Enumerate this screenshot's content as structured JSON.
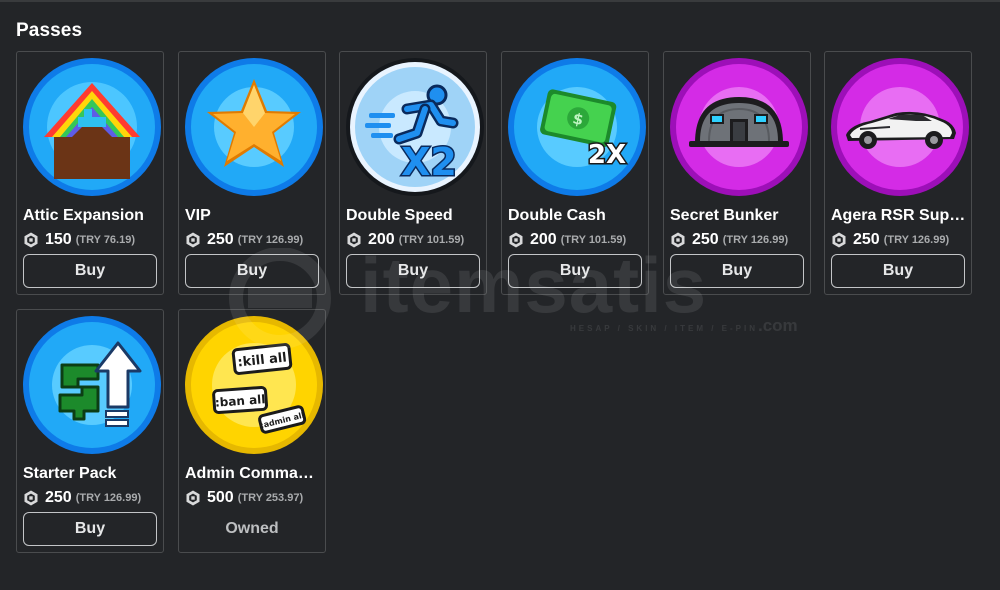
{
  "section": {
    "title": "Passes"
  },
  "passes": [
    {
      "name": "Attic Expansion",
      "price": "150",
      "local_price": "(TRY 76.19)",
      "action": "Buy",
      "icon": "attic-house-icon"
    },
    {
      "name": "VIP",
      "price": "250",
      "local_price": "(TRY 126.99)",
      "action": "Buy",
      "icon": "star-icon"
    },
    {
      "name": "Double Speed",
      "price": "200",
      "local_price": "(TRY 101.59)",
      "action": "Buy",
      "icon": "running-person-icon",
      "badge": "X2"
    },
    {
      "name": "Double Cash",
      "price": "200",
      "local_price": "(TRY 101.59)",
      "action": "Buy",
      "icon": "cash-icon",
      "badge": "2X"
    },
    {
      "name": "Secret Bunker",
      "price": "250",
      "local_price": "(TRY 126.99)",
      "action": "Buy",
      "icon": "bunker-icon"
    },
    {
      "name": "Agera RSR Super...",
      "price": "250",
      "local_price": "(TRY 126.99)",
      "action": "Buy",
      "icon": "sports-car-icon"
    },
    {
      "name": "Starter Pack",
      "price": "250",
      "local_price": "(TRY 126.99)",
      "action": "Buy",
      "icon": "dollar-up-arrow-icon"
    },
    {
      "name": "Admin Commands",
      "price": "500",
      "local_price": "(TRY 253.97)",
      "action": "Owned",
      "icon": "chat-bubbles-icon",
      "bubbles": [
        ":kill all",
        ":ban all",
        ":admin all"
      ]
    }
  ],
  "watermark": {
    "brand": "itemsatis",
    "tagline": "HESAP / SKIN / ITEM / E-PIN",
    "suffix": ".com"
  },
  "colors": {
    "background": "#232528",
    "card_border": "#4a4c4e",
    "blue_ring": "#1e90ff",
    "purple_ring": "#c21bd6",
    "yellow_ring": "#ffd400"
  }
}
